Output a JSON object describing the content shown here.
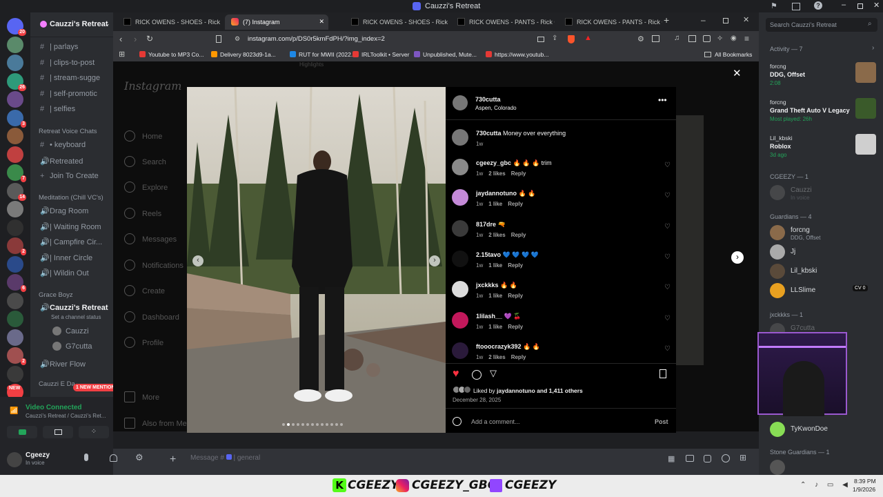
{
  "window_title": "Cauzzi's Retreat",
  "discord": {
    "server_name": "Cauzzi's Retreat",
    "search_placeholder": "Search Cauzzi's Retreat",
    "channels": [
      {
        "name": "| parlays",
        "icon": "hash"
      },
      {
        "name": "| clips-to-post",
        "icon": "hash"
      },
      {
        "name": "| stream-sugge",
        "icon": "hash"
      },
      {
        "name": "| self-promotic",
        "icon": "hash"
      },
      {
        "name": "| selfies",
        "icon": "hash"
      }
    ],
    "voice_category": "Retreat Voice Chats",
    "voice_channels": [
      {
        "name": "• keyboard",
        "icon": "hash"
      },
      {
        "name": "Retreated",
        "icon": "speaker"
      },
      {
        "name": "Join To Create",
        "icon": "plus"
      }
    ],
    "meditation_category": "Meditation (Chill VC's)",
    "meditation_channels": [
      {
        "name": "Drag Room"
      },
      {
        "name": "| Waiting Room"
      },
      {
        "name": "| Campfire Cir..."
      },
      {
        "name": "| Inner Circle"
      },
      {
        "name": "| Wildin Out"
      }
    ],
    "grace_category": "Grace Boyz",
    "grace_channel": "Cauzzi's Retreat",
    "grace_status": "Set a channel status",
    "grace_members": [
      "Cauzzi",
      "G7cutta"
    ],
    "river_flow": "River Flow",
    "next_category": "Cauzzi E Da",
    "new_mentions": "1 NEW MENTION",
    "new_badge": "NEW",
    "video_connected": "Video Connected",
    "video_sub": "Cauzzi's Retreat / Cauzzi's Ret...",
    "user_name": "Cgeezy",
    "user_status": "In voice",
    "message_placeholder": "Message #",
    "message_channel": "| general",
    "server_badges": [
      "20",
      "",
      "",
      "26",
      "",
      "3",
      "",
      "",
      "7",
      "14",
      "",
      "",
      "2",
      "",
      "6",
      "",
      "",
      "",
      "2",
      "",
      ""
    ]
  },
  "members": {
    "activity_header": "Activity — 7",
    "activities": [
      {
        "user": "forcng",
        "title": "DDG, Offset",
        "sub": "2:08"
      },
      {
        "user": "forcng",
        "title": "Grand Theft Auto V Legacy",
        "sub": "Most played: 26h"
      },
      {
        "user": "Lil_kbski",
        "title": "Roblox",
        "sub": "3d ago"
      }
    ],
    "cgeezy_header": "CGEEZY — 1",
    "cgeezy_member": "Cauzzi",
    "cgeezy_member_status": "In voice",
    "guardians_header": "Guardians — 4",
    "guardians": [
      {
        "name": "forcng",
        "sub": "DDG, Offset"
      },
      {
        "name": "Jj",
        "sub": ""
      },
      {
        "name": "Lil_kbski",
        "sub": ""
      },
      {
        "name": "LLSlime",
        "sub": ""
      }
    ],
    "llslime_tag": "CV 0",
    "jxckkks_header": "jxckkks — 1",
    "jxckkks_member": "G7cutta",
    "tykwon": "TyKwonDoe",
    "stone_header": "Stone Guardians — 1"
  },
  "browser": {
    "tabs": [
      {
        "label": "RICK OWENS - SHOES - Rick Owens",
        "active": false
      },
      {
        "label": "(7) Instagram",
        "active": true
      },
      {
        "label": "RICK OWENS - SHOES - Rick Owens",
        "active": false
      },
      {
        "label": "RICK OWENS - PANTS - Rick Owens",
        "active": false
      },
      {
        "label": "RICK OWENS - PANTS - Rick Owens",
        "active": false
      }
    ],
    "url": "instagram.com/p/DS0r5kmFdPH/?img_index=2",
    "bookmarks": [
      {
        "label": "Youtube to MP3 Co...",
        "color": "#e53935"
      },
      {
        "label": "Delivery 8023d9-1a...",
        "color": "#ff9800"
      },
      {
        "label": "RUT for MWII (2022...",
        "color": "#1e88e5"
      },
      {
        "label": "IRLToolkit • Server",
        "color": "#e53935"
      },
      {
        "label": "Unpublished, Mute...",
        "color": "#7e57c2"
      },
      {
        "label": "https://www.youtub...",
        "color": "#e53935"
      }
    ],
    "all_bookmarks": "All Bookmarks"
  },
  "instagram": {
    "logo": "Instagram",
    "nav": [
      "Home",
      "Search",
      "Explore",
      "Reels",
      "Messages",
      "Notifications",
      "Create",
      "Dashboard",
      "Profile"
    ],
    "more": "More",
    "also_from": "Also from Meta",
    "hidden_header": "Highlights",
    "post_user": "730cutta",
    "post_location": "Aspen, Colorado",
    "caption_user": "730cutta",
    "caption_text": "Money over everything",
    "caption_time": "1w",
    "comments": [
      {
        "user": "cgeezy_gbc",
        "text": "🔥 🔥 🔥 trim",
        "time": "1w",
        "likes": "2 likes",
        "reply": "Reply",
        "avatar": "#8a8a8a"
      },
      {
        "user": "jaydannotuno",
        "text": "🔥 🔥",
        "time": "1w",
        "likes": "1 like",
        "reply": "Reply",
        "avatar": "#c48ad8"
      },
      {
        "user": "817dre",
        "text": "🔫",
        "time": "1w",
        "likes": "2 likes",
        "reply": "Reply",
        "avatar": "#3a3a3a"
      },
      {
        "user": "2.15tavo",
        "text": "💙 💙 💙 💙",
        "time": "1w",
        "likes": "1 like",
        "reply": "Reply",
        "avatar": "#111111"
      },
      {
        "user": "jxckkks",
        "text": "🔥 🔥",
        "time": "1w",
        "likes": "1 like",
        "reply": "Reply",
        "avatar": "#dcdcdc"
      },
      {
        "user": "1lilash__",
        "text": "💜 🍒",
        "time": "1w",
        "likes": "1 like",
        "reply": "Reply",
        "avatar": "#c2185b"
      },
      {
        "user": "ftooocrazyk392",
        "text": "🔥 🔥",
        "time": "1w",
        "likes": "2 likes",
        "reply": "Reply",
        "avatar": "#2a1a3a"
      }
    ],
    "liked_by_prefix": "Liked by",
    "liked_by_user": "jaydannotuno",
    "liked_by_suffix": "and 1,411 others",
    "date": "December 28, 2025",
    "add_comment": "Add a comment...",
    "post_button": "Post",
    "carousel_index": 2
  },
  "overlay": {
    "socials": [
      "CGEEZY",
      "CGEEZY_GBC",
      "CGEEZY"
    ]
  },
  "clock": {
    "time": "8:39 PM",
    "date": "1/9/2026"
  },
  "colors": {
    "accent": "#5865f2",
    "like": "#ff3040",
    "online": "#23a55a"
  }
}
